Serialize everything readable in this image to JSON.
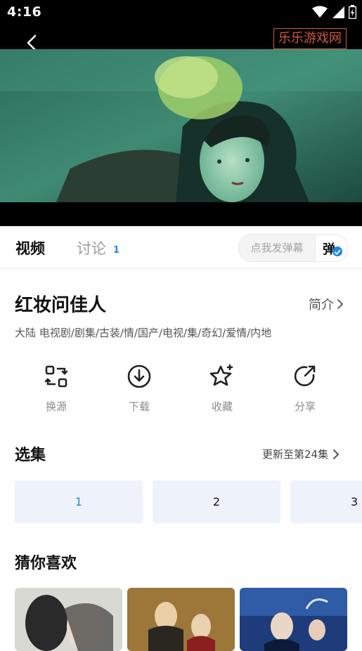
{
  "status_bar": {
    "time": "4:16"
  },
  "player": {
    "watermark": "乐乐游戏网"
  },
  "tabs": {
    "video": "视频",
    "discuss": "讨论",
    "discuss_count": "1",
    "danmu_placeholder": "点我发弹幕",
    "danmu_toggle": "弹"
  },
  "show": {
    "title": "红妆问佳人",
    "intro_label": "简介",
    "tags": "大陆  电视剧/剧集/古装/情/国产/电视/集/奇幻/爱情/内地"
  },
  "actions": [
    {
      "label": "换源",
      "icon": "switch-source-icon"
    },
    {
      "label": "下载",
      "icon": "download-icon"
    },
    {
      "label": "收藏",
      "icon": "star-favorite-icon"
    },
    {
      "label": "分享",
      "icon": "share-icon"
    }
  ],
  "episodes": {
    "heading": "选集",
    "update_text": "更新至第24集",
    "items": [
      "1",
      "2",
      "3"
    ],
    "selected": "1"
  },
  "recommend": {
    "heading": "猜你喜欢"
  },
  "colors": {
    "accent": "#1e88e5",
    "watermark": "#d2583a",
    "episode_bg": "#eef2fa"
  }
}
